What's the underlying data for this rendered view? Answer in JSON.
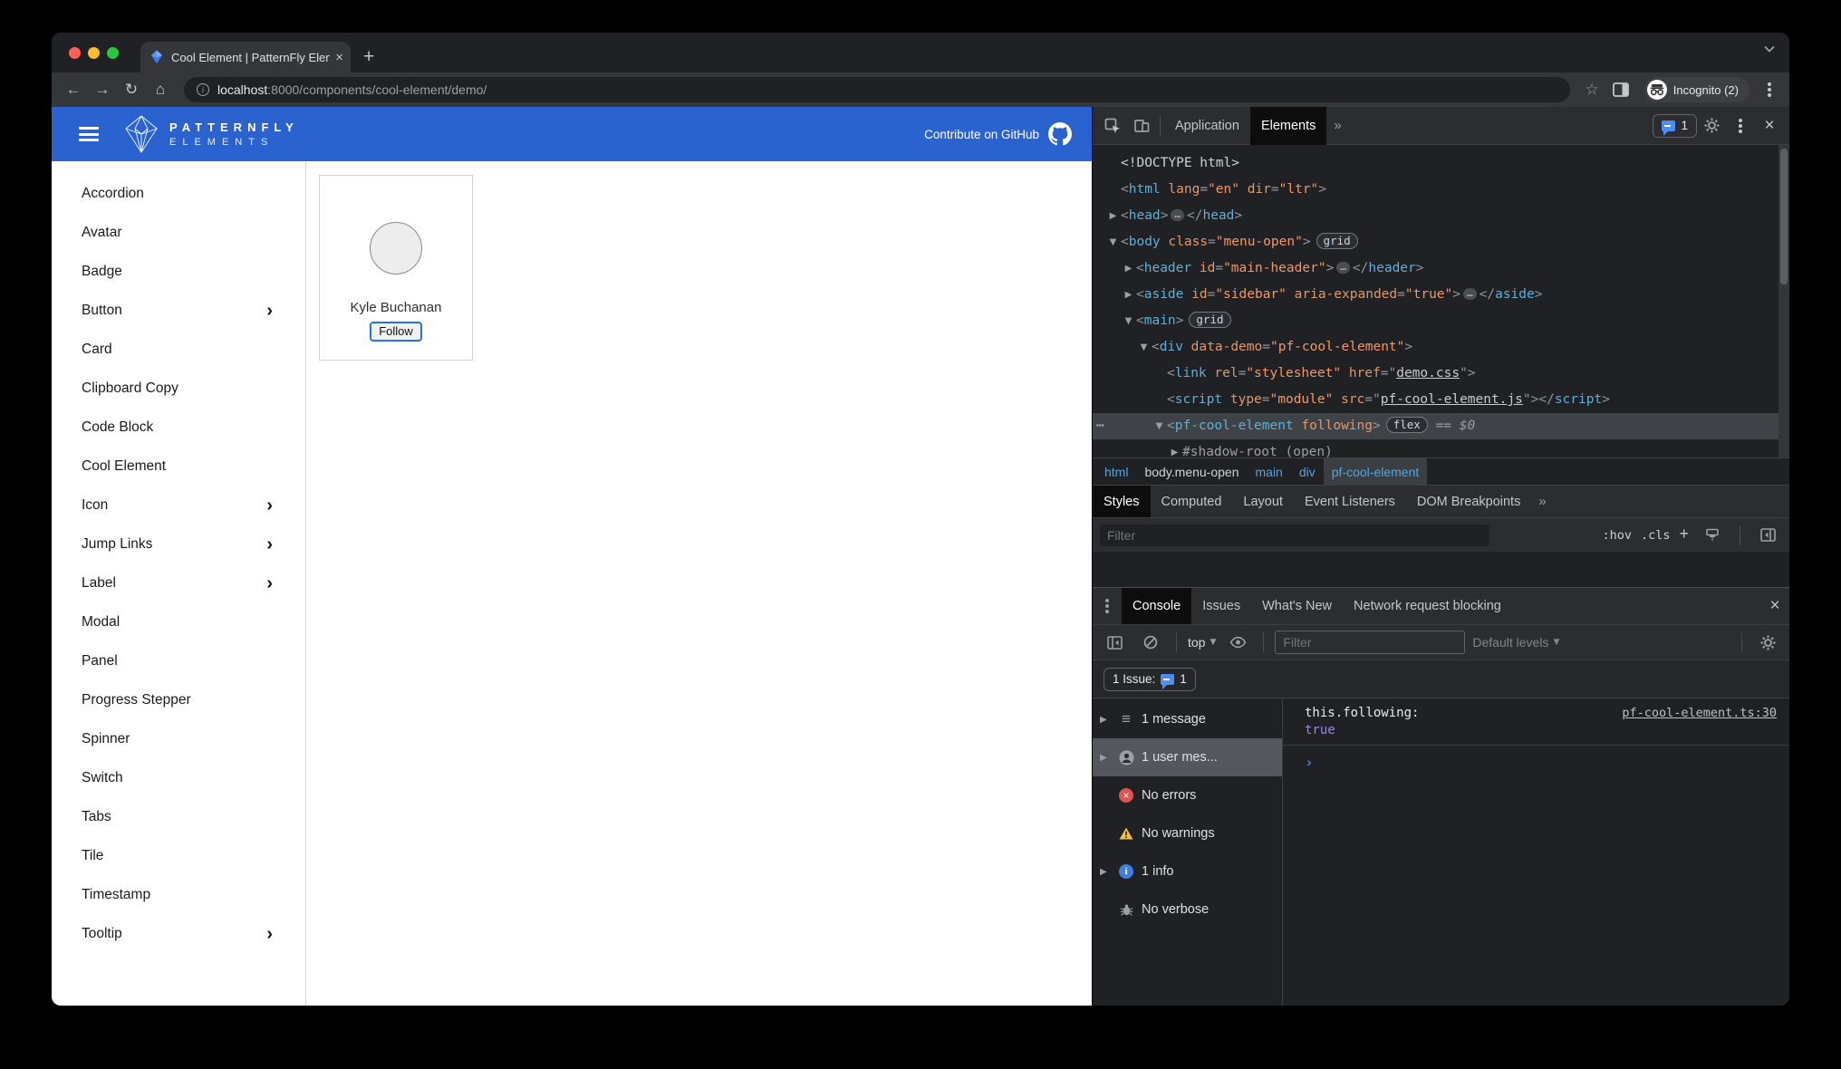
{
  "browser": {
    "tab_title": "Cool Element | PatternFly Eleme",
    "tab_close": "×",
    "new_tab": "+",
    "nav": {
      "back": "←",
      "forward": "→",
      "reload": "↻",
      "home": "⌂",
      "bookmark_star": "☆"
    },
    "url": {
      "info_glyph": "i",
      "host": "localhost",
      "rest": ":8000/components/cool-element/demo/"
    },
    "incognito_label": "Incognito (2)",
    "traffic_colors": {
      "red": "#ff5f57",
      "yellow": "#febc2e",
      "green": "#28c840"
    }
  },
  "site": {
    "accent": "#2a63cf",
    "header": {
      "brand_top": "PATTERNFLY",
      "brand_bottom": "ELEMENTS",
      "contribute": "Contribute on GitHub"
    },
    "sidebar": {
      "items": [
        {
          "label": "Accordion"
        },
        {
          "label": "Avatar"
        },
        {
          "label": "Badge"
        },
        {
          "label": "Button",
          "expandable": true
        },
        {
          "label": "Card"
        },
        {
          "label": "Clipboard Copy"
        },
        {
          "label": "Code Block"
        },
        {
          "label": "Cool Element"
        },
        {
          "label": "Icon",
          "expandable": true
        },
        {
          "label": "Jump Links",
          "expandable": true
        },
        {
          "label": "Label",
          "expandable": true
        },
        {
          "label": "Modal"
        },
        {
          "label": "Panel"
        },
        {
          "label": "Progress Stepper"
        },
        {
          "label": "Spinner"
        },
        {
          "label": "Switch"
        },
        {
          "label": "Tabs"
        },
        {
          "label": "Tile"
        },
        {
          "label": "Timestamp"
        },
        {
          "label": "Tooltip",
          "expandable": true
        }
      ],
      "chevron": "›"
    },
    "demo": {
      "user_name": "Kyle Buchanan",
      "follow_label": "Follow"
    }
  },
  "devtools": {
    "toolbar": {
      "tabs": [
        {
          "label": "Application"
        },
        {
          "label": "Elements",
          "active": true
        }
      ],
      "more": "»",
      "issue_count": "1",
      "close": "×"
    },
    "dom_rows": [
      {
        "d": 0,
        "a": "",
        "t": [
          [
            "w",
            "<!DOCTYPE html>"
          ]
        ]
      },
      {
        "d": 0,
        "a": "",
        "t": [
          [
            "p",
            "<"
          ],
          [
            "t",
            "html"
          ],
          [
            "w",
            " "
          ],
          [
            "a",
            "lang"
          ],
          [
            "p",
            "="
          ],
          [
            "v",
            "\"en\""
          ],
          [
            "w",
            " "
          ],
          [
            "a",
            "dir"
          ],
          [
            "p",
            "="
          ],
          [
            "v",
            "\"ltr\""
          ],
          [
            "p",
            ">"
          ]
        ]
      },
      {
        "d": 0,
        "a": "r",
        "t": [
          [
            "p",
            "<"
          ],
          [
            "t",
            "head"
          ],
          [
            "p",
            ">"
          ],
          [
            "e",
            "…"
          ],
          [
            "p",
            "</"
          ],
          [
            "t",
            "head"
          ],
          [
            "p",
            ">"
          ]
        ]
      },
      {
        "d": 0,
        "a": "d",
        "t": [
          [
            "p",
            "<"
          ],
          [
            "t",
            "body"
          ],
          [
            "w",
            " "
          ],
          [
            "a",
            "class"
          ],
          [
            "p",
            "="
          ],
          [
            "v",
            "\"menu-open\""
          ],
          [
            "p",
            ">"
          ],
          [
            "b",
            "grid"
          ]
        ]
      },
      {
        "d": 1,
        "a": "r",
        "t": [
          [
            "p",
            "<"
          ],
          [
            "t",
            "header"
          ],
          [
            "w",
            " "
          ],
          [
            "a",
            "id"
          ],
          [
            "p",
            "="
          ],
          [
            "v",
            "\"main-header\""
          ],
          [
            "p",
            ">"
          ],
          [
            "e",
            "…"
          ],
          [
            "p",
            "</"
          ],
          [
            "t",
            "header"
          ],
          [
            "p",
            ">"
          ]
        ]
      },
      {
        "d": 1,
        "a": "r",
        "t": [
          [
            "p",
            "<"
          ],
          [
            "t",
            "aside"
          ],
          [
            "w",
            " "
          ],
          [
            "a",
            "id"
          ],
          [
            "p",
            "="
          ],
          [
            "v",
            "\"sidebar\""
          ],
          [
            "w",
            " "
          ],
          [
            "a",
            "aria-expanded"
          ],
          [
            "p",
            "="
          ],
          [
            "v",
            "\"true\""
          ],
          [
            "p",
            ">"
          ],
          [
            "e",
            "…"
          ],
          [
            "p",
            "</"
          ],
          [
            "t",
            "aside"
          ],
          [
            "p",
            ">"
          ]
        ]
      },
      {
        "d": 1,
        "a": "d",
        "t": [
          [
            "p",
            "<"
          ],
          [
            "t",
            "main"
          ],
          [
            "p",
            ">"
          ],
          [
            "b",
            "grid"
          ]
        ]
      },
      {
        "d": 2,
        "a": "d",
        "t": [
          [
            "p",
            "<"
          ],
          [
            "t",
            "div"
          ],
          [
            "w",
            " "
          ],
          [
            "a",
            "data-demo"
          ],
          [
            "p",
            "="
          ],
          [
            "v",
            "\"pf-cool-element\""
          ],
          [
            "p",
            ">"
          ]
        ]
      },
      {
        "d": 3,
        "a": "",
        "t": [
          [
            "p",
            "<"
          ],
          [
            "t",
            "link"
          ],
          [
            "w",
            " "
          ],
          [
            "a",
            "rel"
          ],
          [
            "p",
            "="
          ],
          [
            "v",
            "\"stylesheet\""
          ],
          [
            "w",
            " "
          ],
          [
            "a",
            "href"
          ],
          [
            "p",
            "=\""
          ],
          [
            "l",
            "demo.css"
          ],
          [
            "p",
            "\">"
          ]
        ]
      },
      {
        "d": 3,
        "a": "",
        "t": [
          [
            "p",
            "<"
          ],
          [
            "t",
            "script"
          ],
          [
            "w",
            " "
          ],
          [
            "a",
            "type"
          ],
          [
            "p",
            "="
          ],
          [
            "v",
            "\"module\""
          ],
          [
            "w",
            " "
          ],
          [
            "a",
            "src"
          ],
          [
            "p",
            "=\""
          ],
          [
            "l",
            "pf-cool-element.js"
          ],
          [
            "p",
            "\"></"
          ],
          [
            "t",
            "script"
          ],
          [
            "p",
            ">"
          ]
        ]
      },
      {
        "d": 3,
        "a": "d",
        "sel": true,
        "g": "⋯",
        "t": [
          [
            "p",
            "<"
          ],
          [
            "t",
            "pf-cool-element"
          ],
          [
            "w",
            " "
          ],
          [
            "a",
            "following"
          ],
          [
            "p",
            ">"
          ],
          [
            "b",
            "flex"
          ],
          [
            "eq",
            "  == "
          ],
          [
            "d0",
            "$0"
          ]
        ]
      },
      {
        "d": 4,
        "a": "r",
        "t": [
          [
            "sh",
            "#shadow-root (open)"
          ]
        ]
      }
    ],
    "breadcrumbs": [
      {
        "label": "html"
      },
      {
        "label": "body.menu-open",
        "light": true
      },
      {
        "label": "main"
      },
      {
        "label": "div"
      },
      {
        "label": "pf-cool-element",
        "active": true
      }
    ],
    "styles_tabs": [
      {
        "label": "Styles",
        "active": true
      },
      {
        "label": "Computed"
      },
      {
        "label": "Layout"
      },
      {
        "label": "Event Listeners"
      },
      {
        "label": "DOM Breakpoints"
      }
    ],
    "styles_more": "»",
    "styles_filter": {
      "placeholder": "Filter",
      "hov": ":hov",
      "cls": ".cls",
      "plus": "+"
    },
    "console": {
      "tabs": [
        {
          "label": "Console",
          "active": true
        },
        {
          "label": "Issues"
        },
        {
          "label": "What's New"
        },
        {
          "label": "Network request blocking"
        }
      ],
      "close": "×",
      "toolbar": {
        "context": "top",
        "filter_placeholder": "Filter",
        "levels": "Default levels"
      },
      "issue_label": "1 Issue:",
      "issue_count": "1",
      "sidebar": [
        {
          "icon": "list-icon",
          "label": "1 message",
          "expandable": true
        },
        {
          "icon": "user-icon",
          "label": "1 user mes...",
          "expandable": true,
          "selected": true
        },
        {
          "icon": "error-icon",
          "label": "No errors"
        },
        {
          "icon": "warning-icon",
          "label": "No warnings"
        },
        {
          "icon": "info-icon",
          "label": "1 info",
          "expandable": true
        },
        {
          "icon": "verbose-icon",
          "label": "No verbose"
        }
      ],
      "message": {
        "text": "this.following:",
        "value": "true",
        "source": "pf-cool-element.ts:30"
      },
      "prompt": "›"
    },
    "status_colors": {
      "error": "#e05252",
      "warning": "#f2bd42",
      "info": "#3f7de0",
      "boolean": "#9980ff"
    }
  }
}
